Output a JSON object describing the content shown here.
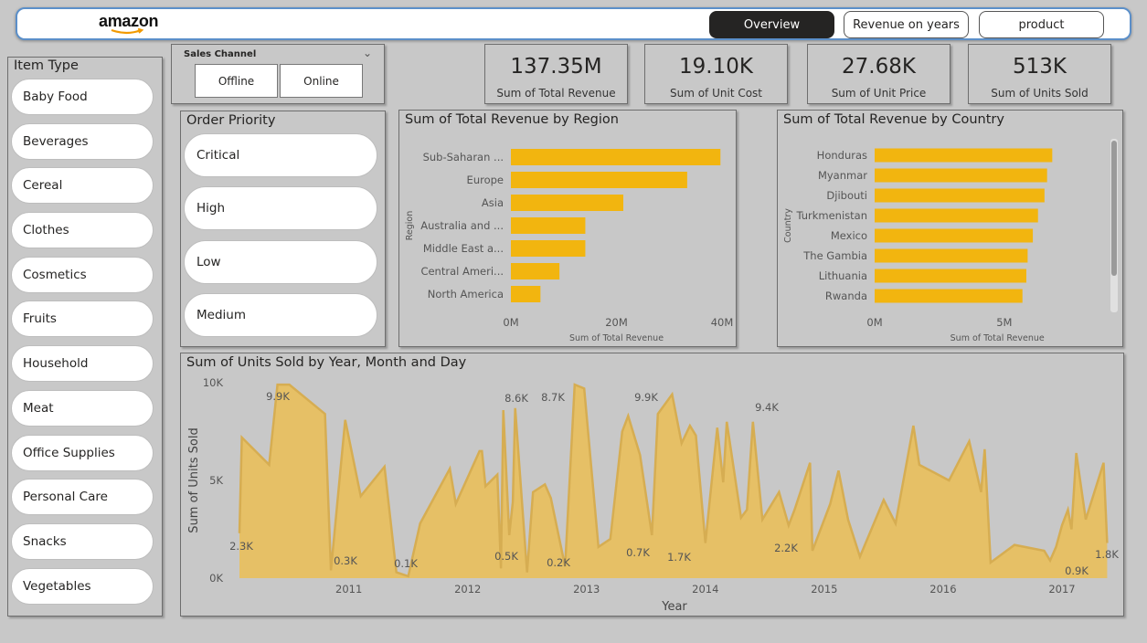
{
  "brand": {
    "logo_text": "amazon"
  },
  "nav": {
    "overview": "Overview",
    "revenue_years": "Revenue on years",
    "product": "product"
  },
  "item_type": {
    "title": "Item Type",
    "items": [
      "Baby Food",
      "Beverages",
      "Cereal",
      "Clothes",
      "Cosmetics",
      "Fruits",
      "Household",
      "Meat",
      "Office Supplies",
      "Personal Care",
      "Snacks",
      "Vegetables"
    ]
  },
  "sales_channel": {
    "title": "Sales Channel",
    "options": [
      "Offline",
      "Online"
    ]
  },
  "order_priority": {
    "title": "Order Priority",
    "items": [
      "Critical",
      "High",
      "Low",
      "Medium"
    ]
  },
  "kpis": [
    {
      "value": "137.35M",
      "label": "Sum of Total Revenue"
    },
    {
      "value": "19.10K",
      "label": "Sum of Unit Cost"
    },
    {
      "value": "27.68K",
      "label": "Sum of Unit Price"
    },
    {
      "value": "513K",
      "label": "Sum of Units Sold"
    }
  ],
  "colors": {
    "bar": "#f2b50f",
    "area_fill": "#e6c066",
    "area_line": "#d6ad52",
    "nav_active": "#252423"
  },
  "chart_data": [
    {
      "type": "bar",
      "orientation": "horizontal",
      "title": "Sum of Total Revenue by Region",
      "xlabel": "Sum of Total Revenue",
      "ylabel": "Region",
      "categories": [
        "Sub-Saharan ...",
        "Europe",
        "Asia",
        "Australia and ...",
        "Middle East a...",
        "Central Ameri...",
        "North America"
      ],
      "values": [
        39.7,
        33.4,
        21.3,
        14.1,
        14.1,
        9.2,
        5.6
      ],
      "ticks": [
        "0M",
        "20M",
        "40M"
      ],
      "xlim": [
        0,
        40
      ],
      "unit": "M"
    },
    {
      "type": "bar",
      "orientation": "horizontal",
      "title": "Sum of Total Revenue by Country",
      "xlabel": "Sum of Total Revenue",
      "ylabel": "Country",
      "categories": [
        "Honduras",
        "Myanmar",
        "Djibouti",
        "Turkmenistan",
        "Mexico",
        "The Gambia",
        "Lithuania",
        "Rwanda"
      ],
      "values": [
        6.85,
        6.65,
        6.55,
        6.3,
        6.1,
        5.9,
        5.85,
        5.7
      ],
      "ticks": [
        "0M",
        "5M"
      ],
      "xlim": [
        0,
        8.6
      ],
      "unit": "M"
    },
    {
      "type": "area",
      "title": "Sum of Units Sold by Year, Month and Day",
      "xlabel": "Year",
      "ylabel": "Sum of Units Sold",
      "ylim": [
        0,
        10000
      ],
      "y_ticks": [
        "0K",
        "5K",
        "10K"
      ],
      "x_ticks": [
        "2011",
        "2012",
        "2013",
        "2014",
        "2015",
        "2016",
        "2017"
      ],
      "xlim": [
        2010.08,
        2017.4
      ],
      "x": [
        2010.08,
        2010.1,
        2010.33,
        2010.4,
        2010.5,
        2010.8,
        2010.85,
        2010.97,
        2011.1,
        2011.3,
        2011.4,
        2011.5,
        2011.6,
        2011.85,
        2011.9,
        2012.1,
        2012.12,
        2012.15,
        2012.25,
        2012.28,
        2012.3,
        2012.35,
        2012.38,
        2012.4,
        2012.5,
        2012.55,
        2012.65,
        2012.7,
        2012.82,
        2012.9,
        2012.98,
        2013.1,
        2013.2,
        2013.3,
        2013.35,
        2013.45,
        2013.55,
        2013.6,
        2013.72,
        2013.8,
        2013.87,
        2013.92,
        2014.0,
        2014.1,
        2014.15,
        2014.18,
        2014.3,
        2014.35,
        2014.4,
        2014.48,
        2014.62,
        2014.7,
        2014.75,
        2014.88,
        2014.9,
        2015.05,
        2015.12,
        2015.2,
        2015.3,
        2015.5,
        2015.6,
        2015.75,
        2015.8,
        2016.05,
        2016.22,
        2016.32,
        2016.35,
        2016.4,
        2016.6,
        2016.85,
        2016.9,
        2016.95,
        2017.0,
        2017.05,
        2017.08,
        2017.12,
        2017.2,
        2017.35,
        2017.38
      ],
      "values": [
        2300,
        7200,
        5800,
        9900,
        9900,
        8400,
        400,
        8100,
        4200,
        5700,
        300,
        100,
        2800,
        5600,
        3800,
        6500,
        6500,
        4700,
        5300,
        500,
        8600,
        2200,
        3900,
        8700,
        300,
        4400,
        4800,
        4100,
        600,
        9900,
        9700,
        1600,
        2000,
        7500,
        8300,
        6300,
        2200,
        8400,
        9400,
        6900,
        7800,
        7300,
        1800,
        7700,
        4900,
        8000,
        3100,
        3500,
        8000,
        3000,
        4400,
        2700,
        3500,
        5900,
        1400,
        3800,
        5500,
        3000,
        1100,
        4000,
        2800,
        7800,
        5800,
        5000,
        7000,
        4400,
        6600,
        800,
        1700,
        1400,
        900,
        1600,
        2700,
        3500,
        2500,
        6400,
        3000,
        5900,
        1800
      ],
      "data_labels": [
        {
          "text": "2.3K"
        },
        {
          "text": "9.9K"
        },
        {
          "text": "0.3K"
        },
        {
          "text": "0.1K"
        },
        {
          "text": "0.5K"
        },
        {
          "text": "8.6K"
        },
        {
          "text": "8.7K"
        },
        {
          "text": "0.2K"
        },
        {
          "text": "0.7K"
        },
        {
          "text": "9.9K"
        },
        {
          "text": "1.7K"
        },
        {
          "text": "9.4K"
        },
        {
          "text": "2.2K"
        },
        {
          "text": "0.9K"
        },
        {
          "text": "1.8K"
        }
      ]
    }
  ]
}
